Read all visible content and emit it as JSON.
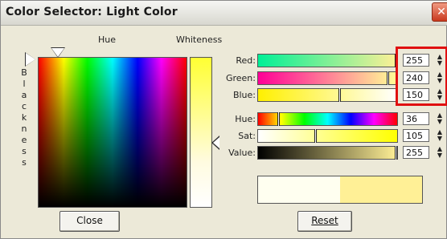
{
  "window": {
    "title": "Color Selector: Light Color",
    "close_symbol": "✕"
  },
  "headers": {
    "hue": "Hue",
    "whiteness": "Whiteness",
    "blackness": "Blackness"
  },
  "rows": [
    {
      "label": "Red:",
      "value": "255",
      "fraction": 1.0
    },
    {
      "label": "Green:",
      "value": "240",
      "fraction": 0.94
    },
    {
      "label": "Blue:",
      "value": "150",
      "fraction": 0.59
    },
    {
      "label": "Hue:",
      "value": "36",
      "fraction": 0.14
    },
    {
      "label": "Sat:",
      "value": "105",
      "fraction": 0.41
    },
    {
      "label": "Value:",
      "value": "255",
      "fraction": 1.0
    }
  ],
  "buttons": {
    "close": "Close",
    "reset": "Reset"
  },
  "colors": {
    "current": "#fffff0",
    "selected": "#fff096",
    "highlight": "#e01010"
  }
}
